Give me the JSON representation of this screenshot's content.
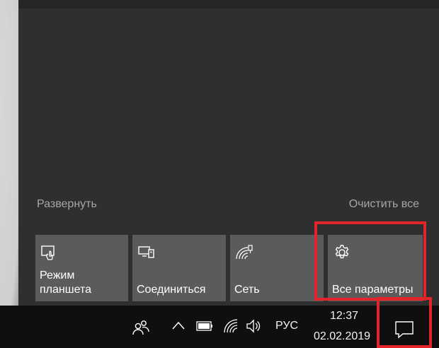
{
  "action_center": {
    "expand_label": "Развернуть",
    "clear_all_label": "Очистить все",
    "tiles": [
      {
        "label": "Режим\nпланшета",
        "icon": "tablet-mode-icon"
      },
      {
        "label": "Соединиться",
        "icon": "connect-icon"
      },
      {
        "label": "Сеть",
        "icon": "network-icon"
      },
      {
        "label": "Все параметры",
        "icon": "gear-icon"
      }
    ]
  },
  "taskbar": {
    "language": "РУС",
    "time": "12:37",
    "date": "02.02.2019",
    "icons": [
      "people-icon",
      "chevron-up-icon",
      "battery-icon",
      "wifi-icon",
      "volume-icon",
      "notification-icon"
    ]
  },
  "colors": {
    "panel_bg": "#2f2f2f",
    "tile_bg": "#5b5b5b",
    "taskbar_bg": "#0f0f0f",
    "highlight": "#e3242b"
  }
}
